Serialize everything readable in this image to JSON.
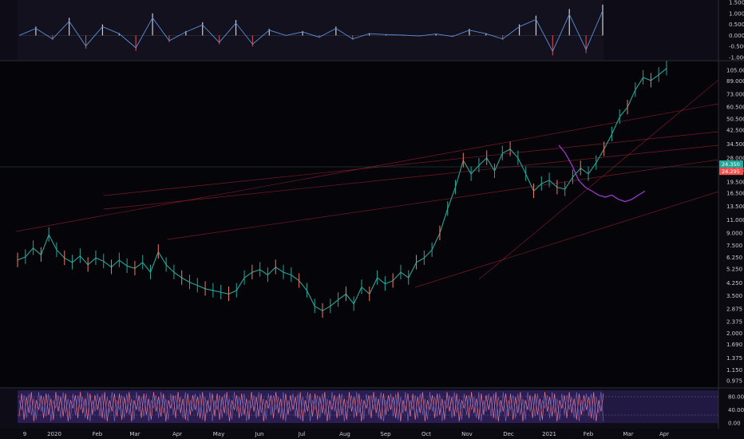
{
  "chart_data": [
    {
      "type": "line",
      "pane": "oscillator-top",
      "title": "",
      "y_ticks": [
        "1.500",
        "1.000",
        "0.500",
        "0.000",
        "-0.500",
        "-1.000"
      ],
      "ylim": [
        -1.0,
        1.5
      ],
      "grid": false,
      "series": [
        {
          "values": [
            0.0,
            0.4,
            -0.2,
            0.8,
            -0.6,
            0.5,
            0.1,
            -0.7,
            1.0,
            -0.3,
            0.2,
            0.6,
            -0.4,
            0.7,
            -0.5,
            0.3,
            0.0,
            0.2,
            -0.1,
            0.4,
            -0.2,
            0.1,
            0.05,
            0.02,
            -0.03,
            0.08,
            -0.06,
            0.3,
            0.1,
            -0.2,
            0.5,
            0.9,
            -0.9,
            1.2,
            -0.8,
            1.4
          ]
        }
      ]
    },
    {
      "type": "line",
      "pane": "price",
      "title": "",
      "y_scale": "log",
      "y_ticks": [
        "105.000",
        "89.000",
        "73.000",
        "60.500",
        "50.500",
        "42.500",
        "34.500",
        "28.000",
        "23.500",
        "19.500",
        "16.500",
        "13.500",
        "11.000",
        "9.000",
        "7.500",
        "6.250",
        "5.250",
        "4.250",
        "3.500",
        "2.875",
        "2.375",
        "2.000",
        "1.690",
        "1.375",
        "1.150",
        "0.975"
      ],
      "price_tags": [
        {
          "text": "24.350",
          "value": 24.35,
          "color": "#26a69a"
        },
        {
          "text": "24.295",
          "value": 24.295,
          "color": "#ef5350"
        }
      ],
      "x_ticks": [
        "9",
        "2020",
        "Feb",
        "Mar",
        "Apr",
        "May",
        "Jun",
        "Jul",
        "Aug",
        "Sep",
        "Oct",
        "Nov",
        "Dec",
        "2021",
        "Feb",
        "Mar",
        "Apr"
      ],
      "grid": false,
      "series": [
        {
          "name": "",
          "color": "#26a69a",
          "values": [
            6.0,
            6.3,
            7.2,
            6.5,
            8.8,
            7.0,
            6.2,
            5.8,
            6.4,
            5.6,
            6.2,
            5.9,
            5.4,
            6.0,
            5.5,
            5.3,
            5.8,
            5.0,
            6.8,
            5.6,
            5.0,
            4.6,
            4.3,
            4.1,
            3.9,
            3.8,
            3.7,
            3.6,
            3.8,
            4.6,
            5.0,
            5.2,
            4.8,
            5.4,
            5.0,
            4.8,
            4.4,
            3.8,
            3.0,
            2.8,
            3.0,
            3.3,
            3.6,
            3.1,
            4.0,
            3.6,
            4.6,
            4.2,
            4.4,
            5.0,
            4.6,
            5.8,
            6.2,
            7.0,
            9.0,
            13.0,
            18.0,
            27.0,
            22.0,
            25.0,
            28.0,
            23.0,
            30.0,
            32.0,
            28.0,
            22.0,
            17.0,
            19.0,
            20.0,
            18.0,
            17.5,
            21.0,
            24.0,
            22.0,
            26.0,
            32.0,
            40.0,
            52.0,
            60.0,
            78.0,
            94.0,
            90.0,
            98.0,
            108.0
          ]
        },
        {
          "name": "",
          "color": "#a43bd6",
          "values": [
            34.0,
            30.0,
            25.0,
            20.0,
            18.0,
            17.0,
            16.0,
            15.5,
            16.0,
            15.0,
            14.5,
            15.0,
            16.0,
            17.0
          ]
        }
      ]
    },
    {
      "type": "area",
      "pane": "oscillator-bottom",
      "title": "",
      "y_ticks": [
        "80.00",
        "40.00",
        "0.00"
      ],
      "ylim": [
        0,
        100
      ],
      "grid": false,
      "series": [
        {
          "values": [
            20,
            90,
            10,
            80,
            30,
            95,
            5,
            70,
            40,
            85,
            15,
            90,
            25,
            75,
            10,
            95,
            35,
            80,
            20,
            90,
            5,
            70,
            45,
            85,
            15,
            95,
            30,
            75,
            10,
            90,
            25,
            85,
            40,
            80,
            15,
            95,
            5,
            70,
            35,
            90
          ]
        }
      ]
    }
  ]
}
